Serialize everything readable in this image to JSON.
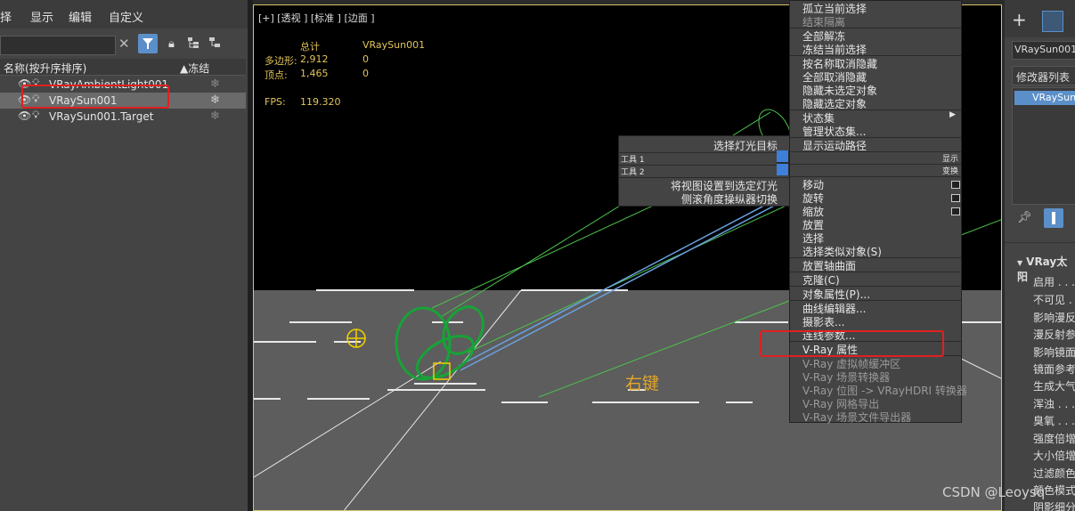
{
  "menubar": {
    "items": [
      "择",
      "显示",
      "编辑",
      "自定义"
    ]
  },
  "explorer": {
    "col_name": "名称(按升序排序)",
    "col_freeze": "▲冻结",
    "rows": [
      {
        "label": "VRayAmbientLight001"
      },
      {
        "label": "VRaySun001"
      },
      {
        "label": "VRaySun001.Target"
      }
    ]
  },
  "viewport": {
    "label": "[+] [透视 ] [标准 ] [边面 ]",
    "stats": {
      "total_label": "总计",
      "object_label": "VRaySun001",
      "poly_label": "多边形:",
      "poly_total": "2,912",
      "poly_obj": "0",
      "vert_label": "顶点:",
      "vert_total": "1,465",
      "vert_obj": "0",
      "fps_label": "FPS:",
      "fps_value": "119.320"
    },
    "annotation": "右键"
  },
  "left_quad": {
    "items": [
      {
        "label": "选择灯光目标"
      },
      {
        "label": "工具 1",
        "right": "显示"
      },
      {
        "label": "工具 2",
        "right": "变换"
      },
      {
        "label": "将视图设置到选定灯光"
      },
      {
        "label": "侧滚角度操纵器切换"
      }
    ]
  },
  "right_quad": {
    "items": [
      {
        "label": "孤立当前选择"
      },
      {
        "label": "结束隔离"
      },
      {
        "label": "全部解冻"
      },
      {
        "label": "冻结当前选择"
      },
      {
        "label": "按名称取消隐藏"
      },
      {
        "label": "全部取消隐藏"
      },
      {
        "label": "隐藏未选定对象"
      },
      {
        "label": "隐藏选定对象"
      },
      {
        "label": "状态集"
      },
      {
        "label": "管理状态集..."
      },
      {
        "label": "显示运动路径"
      },
      {
        "label": "移动"
      },
      {
        "label": "旋转"
      },
      {
        "label": "缩放"
      },
      {
        "label": "放置"
      },
      {
        "label": "选择"
      },
      {
        "label": "选择类似对象(S)"
      },
      {
        "label": "放置轴曲面"
      },
      {
        "label": "克隆(C)"
      },
      {
        "label": "对象属性(P)..."
      },
      {
        "label": "曲线编辑器..."
      },
      {
        "label": "摄影表..."
      },
      {
        "label": "连线参数..."
      },
      {
        "label": "V-Ray 属性"
      },
      {
        "label": "V-Ray 虚拟帧缓冲区"
      },
      {
        "label": "V-Ray 场景转换器"
      },
      {
        "label": "V-Ray 位图 -> VRayHDRI 转换器"
      },
      {
        "label": "V-Ray 网格导出"
      },
      {
        "label": "V-Ray 场景文件导出器"
      }
    ]
  },
  "command_panel": {
    "object_name": "VRaySun001",
    "modifier_list": "修改器列表",
    "stack_item": "VRaySun",
    "rollout_title": "VRay太阳",
    "params": [
      "启用",
      "不可见",
      "影响漫反",
      "漫反射参",
      "影响镜面",
      "镜面参考",
      "生成大气",
      "浑浊",
      "臭氧",
      "强度倍增",
      "大小倍增",
      "过滤颜色",
      "颜色模式",
      "阴影细分"
    ]
  },
  "watermark": "CSDN @Leoysq"
}
